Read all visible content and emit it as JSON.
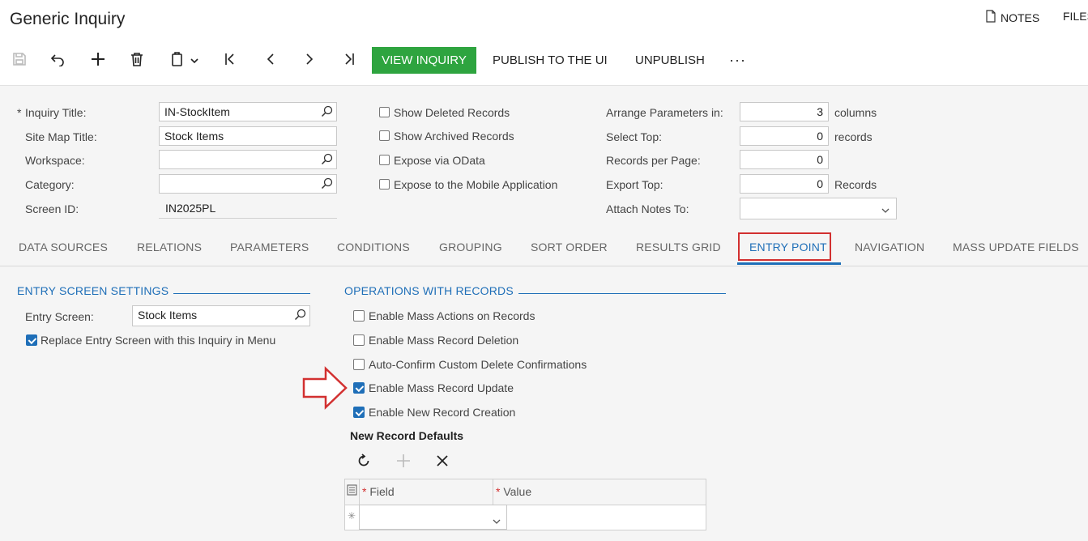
{
  "header": {
    "title": "Generic Inquiry",
    "notes_label": "NOTES",
    "files_label": "FILES"
  },
  "toolbar": {
    "view_inquiry": "VIEW INQUIRY",
    "publish": "PUBLISH TO THE UI",
    "unpublish": "UNPUBLISH",
    "more": "···"
  },
  "form": {
    "inquiry_title": {
      "required_mark": "*",
      "label": "Inquiry Title:",
      "value": "IN-StockItem"
    },
    "site_map_title": {
      "label": "Site Map Title:",
      "value": "Stock Items"
    },
    "workspace": {
      "label": "Workspace:",
      "value": ""
    },
    "category": {
      "label": "Category:",
      "value": ""
    },
    "screen_id": {
      "label": "Screen ID:",
      "value": "IN2025PL"
    },
    "options": [
      {
        "label": "Show Deleted Records",
        "checked": false
      },
      {
        "label": "Show Archived Records",
        "checked": false
      },
      {
        "label": "Expose via OData",
        "checked": false
      },
      {
        "label": "Expose to the Mobile Application",
        "checked": false
      }
    ],
    "arrange_parameters": {
      "label": "Arrange Parameters in:",
      "value": "3",
      "suffix": "columns"
    },
    "select_top": {
      "label": "Select Top:",
      "value": "0",
      "suffix": "records"
    },
    "records_per_page": {
      "label": "Records per Page:",
      "value": "0"
    },
    "export_top": {
      "label": "Export Top:",
      "value": "0",
      "suffix": "Records"
    },
    "attach_notes_to": {
      "label": "Attach Notes To:",
      "value": ""
    }
  },
  "tabs": [
    {
      "label": "DATA SOURCES",
      "active": false
    },
    {
      "label": "RELATIONS",
      "active": false
    },
    {
      "label": "PARAMETERS",
      "active": false
    },
    {
      "label": "CONDITIONS",
      "active": false
    },
    {
      "label": "GROUPING",
      "active": false
    },
    {
      "label": "SORT ORDER",
      "active": false
    },
    {
      "label": "RESULTS GRID",
      "active": false
    },
    {
      "label": "ENTRY POINT",
      "active": true
    },
    {
      "label": "NAVIGATION",
      "active": false
    },
    {
      "label": "MASS UPDATE FIELDS",
      "active": false
    }
  ],
  "entry_screen_settings": {
    "heading": "ENTRY SCREEN SETTINGS",
    "entry_screen": {
      "label": "Entry Screen:",
      "value": "Stock Items"
    },
    "replace_in_menu": {
      "label": "Replace Entry Screen with this Inquiry in Menu",
      "checked": true
    }
  },
  "operations": {
    "heading": "OPERATIONS WITH RECORDS",
    "items": [
      {
        "label": "Enable Mass Actions on Records",
        "checked": false
      },
      {
        "label": "Enable Mass Record Deletion",
        "checked": false
      },
      {
        "label": "Auto-Confirm Custom Delete Confirmations",
        "checked": false
      },
      {
        "label": "Enable Mass Record Update",
        "checked": true
      },
      {
        "label": "Enable New Record Creation",
        "checked": true
      }
    ],
    "new_record_defaults": {
      "title": "New Record Defaults",
      "columns": [
        {
          "required_mark": "*",
          "label": "Field"
        },
        {
          "required_mark": "*",
          "label": "Value"
        }
      ],
      "new_row_marker": "✳"
    }
  },
  "colors": {
    "accent": "#1f6fb8",
    "primary_button": "#2ea43f",
    "highlight": "#d23030"
  }
}
